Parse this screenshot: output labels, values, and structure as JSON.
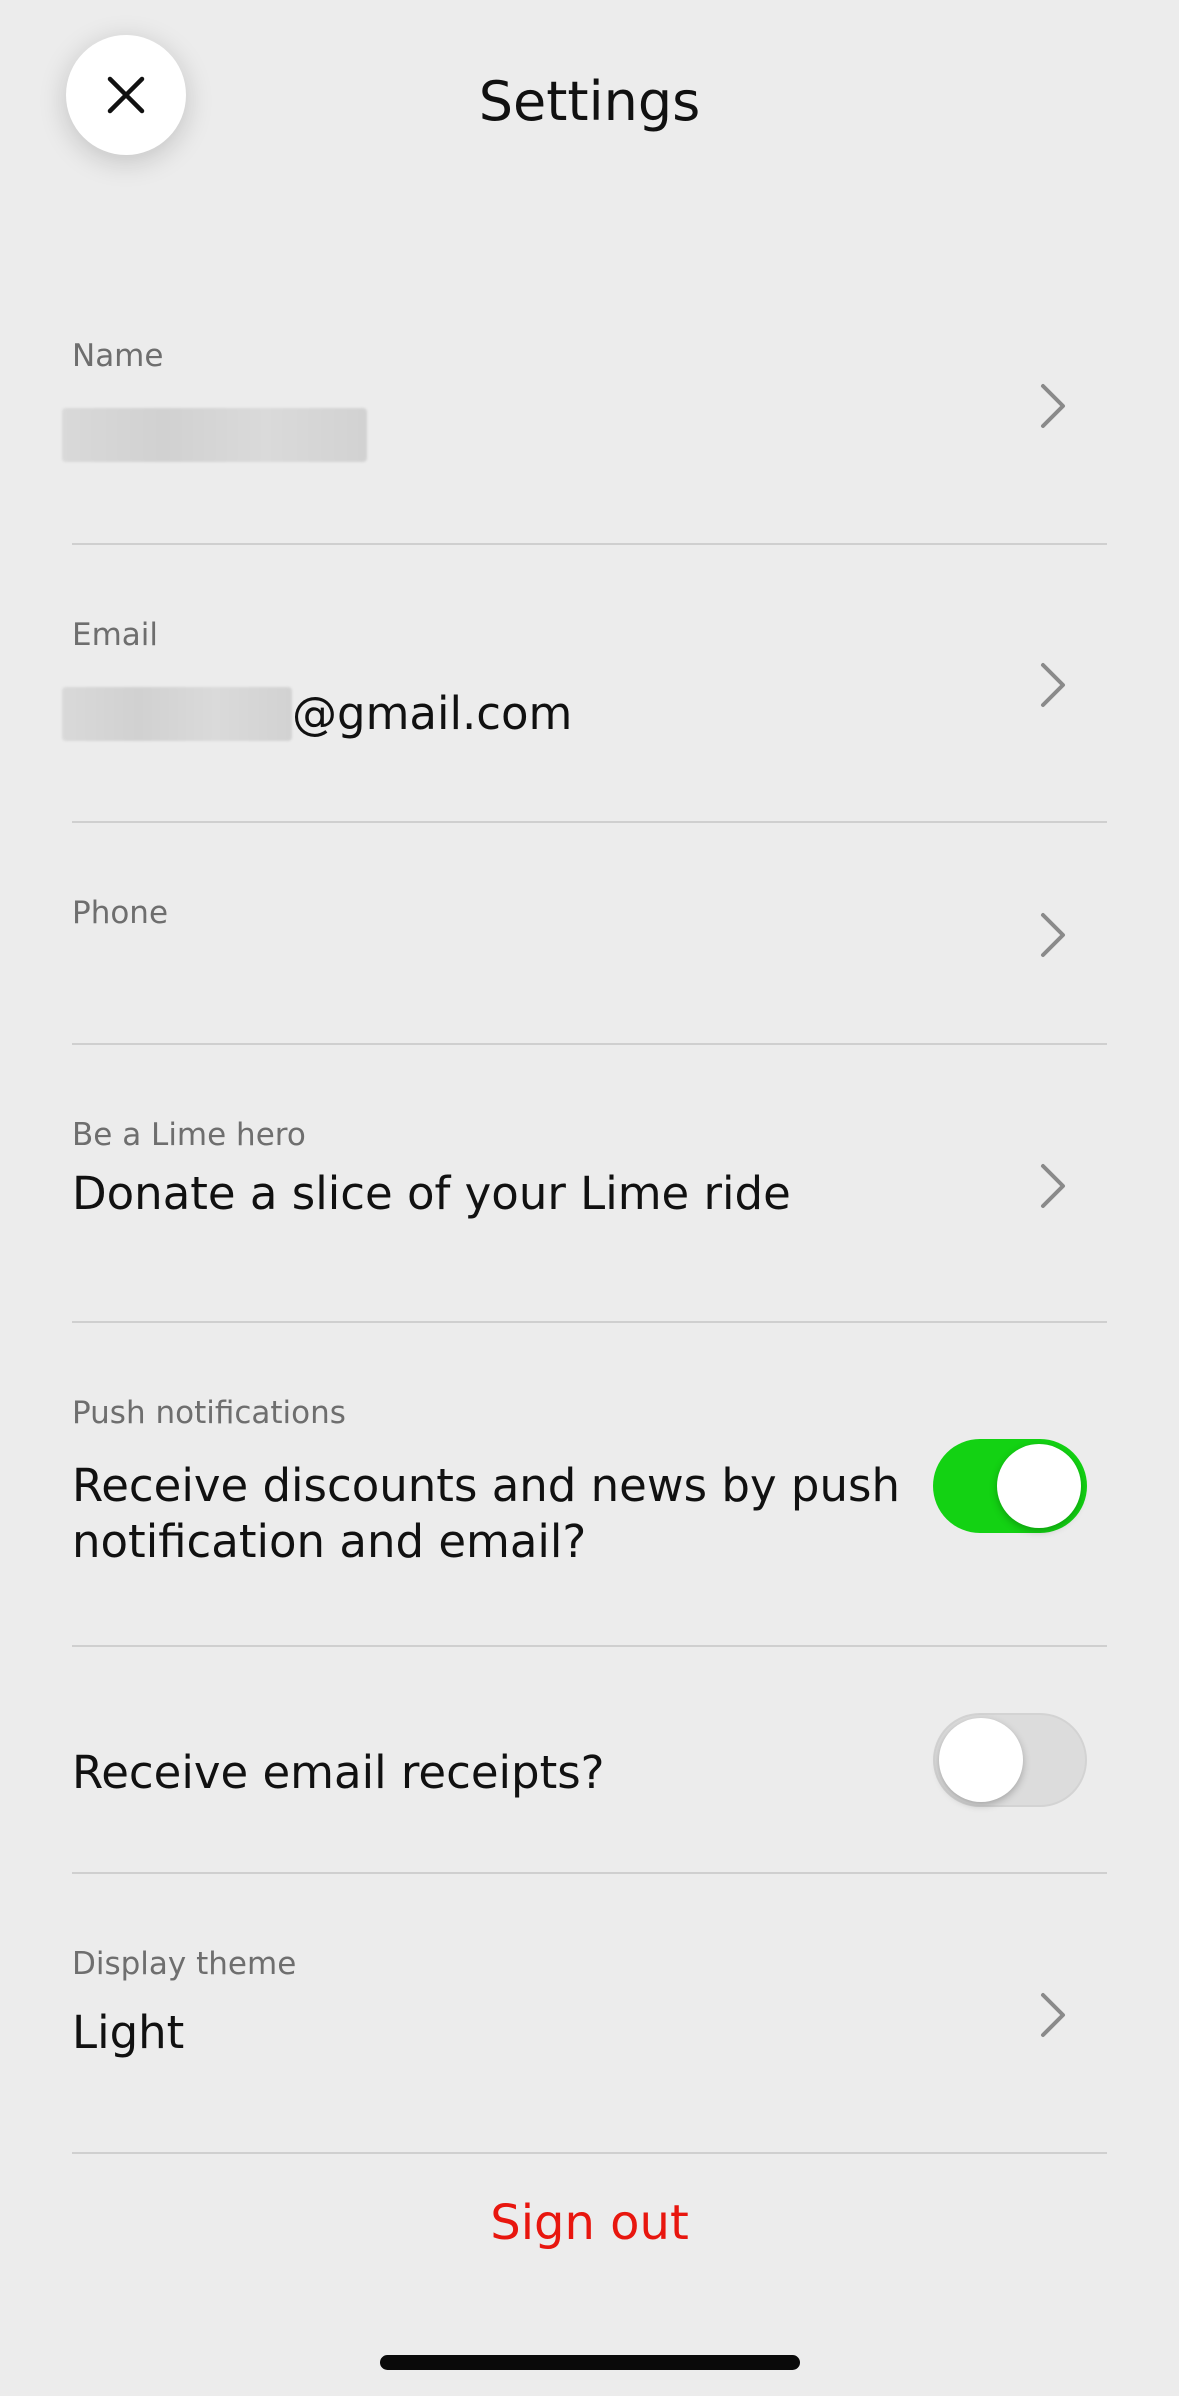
{
  "header": {
    "title": "Settings",
    "close_icon": "close-icon"
  },
  "settings": {
    "name": {
      "label": "Name",
      "value": ""
    },
    "email": {
      "label": "Email",
      "value_suffix": "@gmail.com"
    },
    "phone": {
      "label": "Phone",
      "value": ""
    },
    "lime_hero": {
      "label": "Be a Lime hero",
      "value": "Donate a slice of your Lime ride"
    },
    "push": {
      "label": "Push notifications",
      "line1": "Receive discounts and news by push",
      "line2": "notification and email?",
      "enabled": true
    },
    "receipts": {
      "value": "Receive email receipts?",
      "enabled": false
    },
    "theme": {
      "label": "Display theme",
      "value": "Light"
    }
  },
  "footer": {
    "signout_label": "Sign out"
  },
  "colors": {
    "toggle_on": "#13d213",
    "signout": "#e8160e",
    "background": "#ececec"
  }
}
